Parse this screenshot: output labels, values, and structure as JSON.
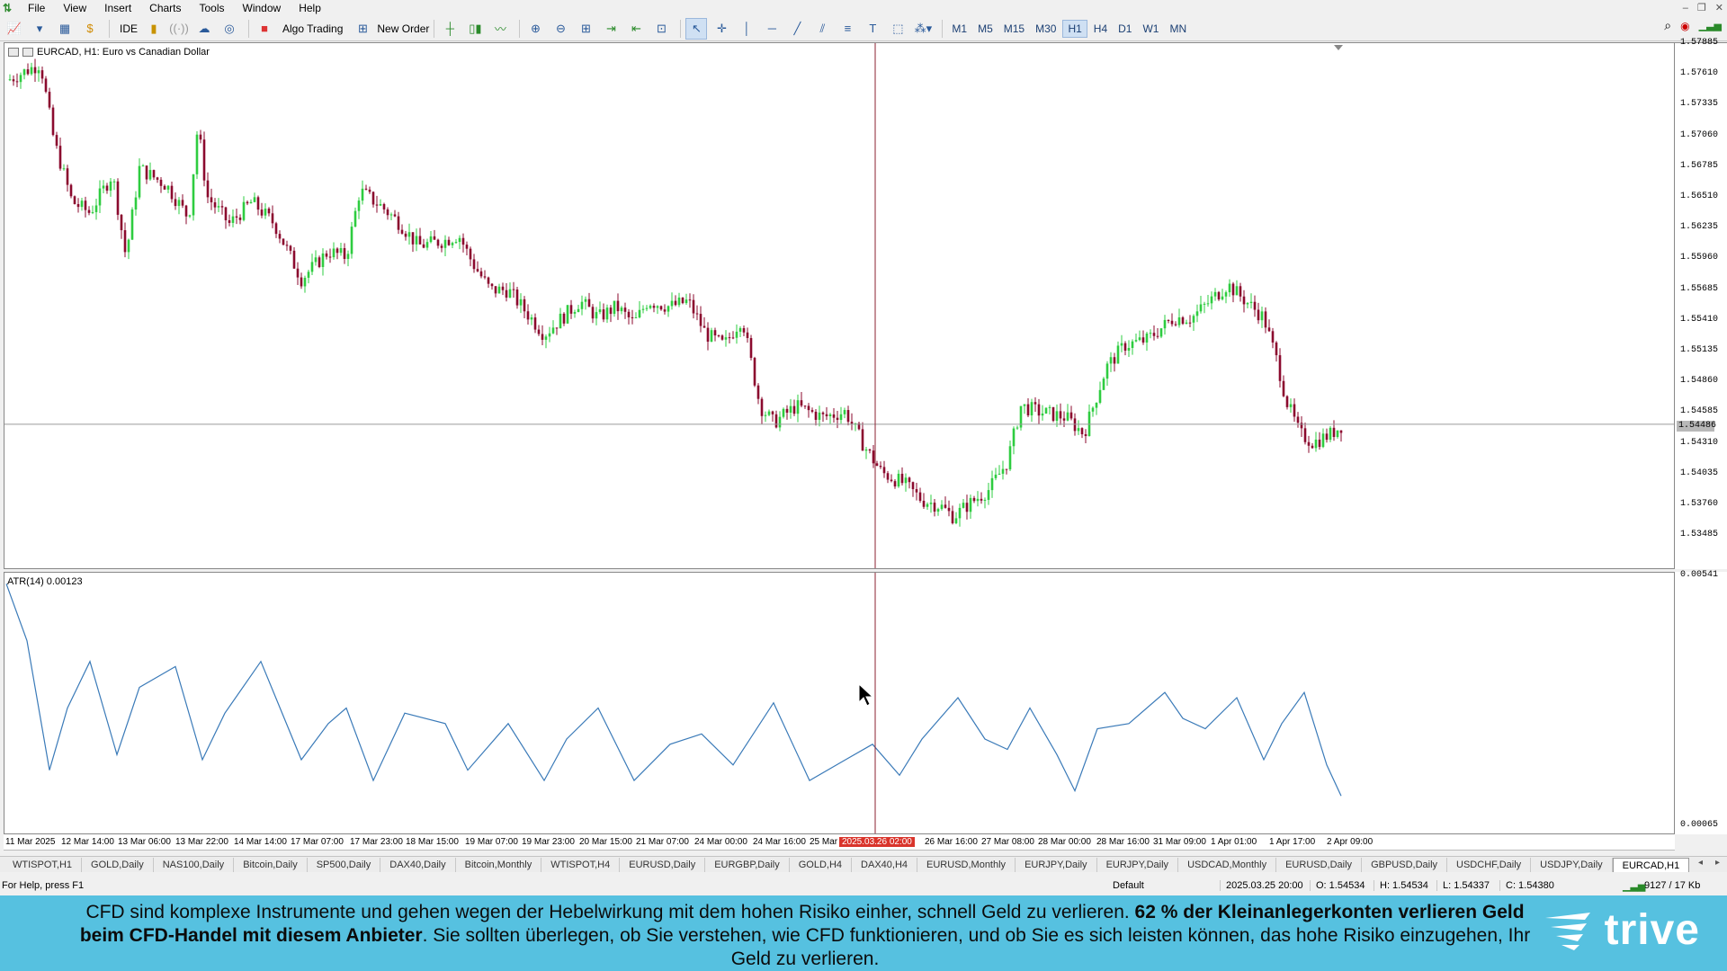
{
  "menu": {
    "items": [
      "File",
      "View",
      "Insert",
      "Charts",
      "Tools",
      "Window",
      "Help"
    ]
  },
  "toolbar": {
    "ide_label": "IDE",
    "algo_label": "Algo Trading",
    "new_order_label": "New Order",
    "timeframes": [
      "M1",
      "M5",
      "M15",
      "M30",
      "H1",
      "H4",
      "D1",
      "W1",
      "MN"
    ],
    "active_timeframe": "H1"
  },
  "chart": {
    "title": "EURCAD, H1:  Euro vs Canadian Dollar",
    "price_ticks": [
      "1.57885",
      "1.57610",
      "1.57335",
      "1.57060",
      "1.56785",
      "1.56510",
      "1.56235",
      "1.55960",
      "1.55685",
      "1.55410",
      "1.55135",
      "1.54860",
      "1.54585",
      "1.54310",
      "1.54035",
      "1.53760",
      "1.53485"
    ],
    "current_price": "1.54486",
    "ind_title": "ATR(14) 0.00123",
    "ind_ticks": [
      "0.00541",
      "0.00065"
    ],
    "time_labels": [
      "11 Mar 2025",
      "12 Mar 14:00",
      "13 Mar 06:00",
      "13 Mar 22:00",
      "14 Mar 14:00",
      "17 Mar 07:00",
      "17 Mar 23:00",
      "18 Mar 15:00",
      "19 Mar 07:00",
      "19 Mar 23:00",
      "20 Mar 15:00",
      "21 Mar 07:00",
      "24 Mar 00:00",
      "24 Mar 16:00",
      "25 Mar",
      "2025.03.26 02:00",
      "26 Mar 16:00",
      "27 Mar 08:00",
      "28 Mar 00:00",
      "28 Mar 16:00",
      "31 Mar 09:00",
      "1 Apr 01:00",
      "1 Apr 17:00",
      "2 Apr 09:00"
    ],
    "crosshair_time": "2025.03.26 02:00",
    "colors": {
      "bull": "#2ecc40",
      "bear": "#8b0a2e",
      "atr": "#3a7ab8",
      "crosshair": "#8b2232"
    }
  },
  "tabs": [
    "WTISPOT,H1",
    "GOLD,Daily",
    "NAS100,Daily",
    "Bitcoin,Daily",
    "SP500,Daily",
    "DAX40,Daily",
    "Bitcoin,Monthly",
    "WTISPOT,H4",
    "EURUSD,Daily",
    "EURGBP,Daily",
    "GOLD,H4",
    "DAX40,H4",
    "EURUSD,Monthly",
    "EURJPY,Daily",
    "EURJPY,Daily",
    "USDCAD,Monthly",
    "EURUSD,Daily",
    "GBPUSD,Daily",
    "USDCHF,Daily",
    "USDJPY,Daily",
    "EURCAD,H1"
  ],
  "active_tab": "EURCAD,H1",
  "status": {
    "help": "For Help, press F1",
    "profile": "Default",
    "datetime": "2025.03.25 20:00",
    "open": "O: 1.54534",
    "high": "H: 1.54534",
    "low": "L: 1.54337",
    "close": "C: 1.54380",
    "traffic": "9127 / 17 Kb"
  },
  "disclaimer": {
    "part1": "CFD sind komplexe Instrumente und gehen wegen der Hebelwirkung mit dem hohen Risiko einher, schnell Geld zu verlieren. ",
    "bold": "62 % der Kleinanlegerkonten verlieren Geld beim CFD-Handel mit diesem Anbieter",
    "part2": ". Sie sollten überlegen, ob Sie verstehen, wie CFD funktionieren, und ob Sie es sich leisten können, das hohe Risiko einzugehen, Ihr Geld zu verlieren.",
    "brand": "trive"
  }
}
